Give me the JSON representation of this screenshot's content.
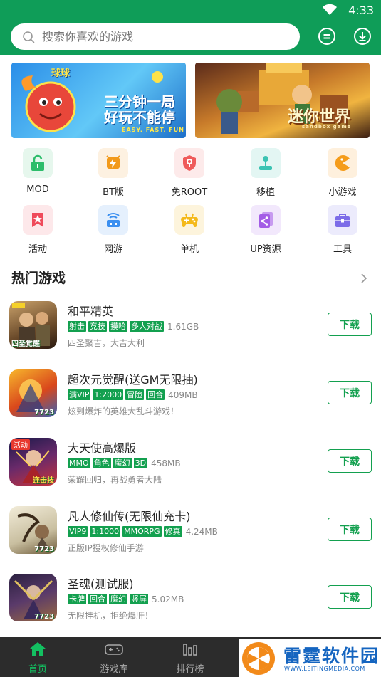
{
  "status_bar": {
    "time": "4:33"
  },
  "search": {
    "placeholder": "搜索你喜欢的游戏"
  },
  "banners": [
    {
      "title": "球球",
      "slogan_line1": "三分钟一局",
      "slogan_line2": "好玩不能停",
      "sub": "EASY. FAST. FUN"
    },
    {
      "title": "迷你世界",
      "sub": "sandbox game"
    }
  ],
  "categories": [
    {
      "label": "MOD",
      "icon": "lock-icon",
      "color": "#2dbd6b",
      "bg": "#e6f7ed"
    },
    {
      "label": "BT版",
      "icon": "bt-icon",
      "color": "#f29a1b",
      "bg": "#fdf1e1"
    },
    {
      "label": "免ROOT",
      "icon": "shield-icon",
      "color": "#ef5b5b",
      "bg": "#fdeaea"
    },
    {
      "label": "移植",
      "icon": "joystick-icon",
      "color": "#3cc3b3",
      "bg": "#e3f6f3"
    },
    {
      "label": "小游戏",
      "icon": "pacman-icon",
      "color": "#f59c1a",
      "bg": "#fef0dd"
    },
    {
      "label": "活动",
      "icon": "star-bookmark-icon",
      "color": "#ef4b5b",
      "bg": "#fde8ea"
    },
    {
      "label": "网游",
      "icon": "network-icon",
      "color": "#3b8ff0",
      "bg": "#e5f0fd"
    },
    {
      "label": "单机",
      "icon": "gamepad-icon",
      "color": "#f4b91a",
      "bg": "#fdf4dc"
    },
    {
      "label": "UP资源",
      "icon": "share-icon",
      "color": "#a35ce6",
      "bg": "#f2e8fc"
    },
    {
      "label": "工具",
      "icon": "toolbox-icon",
      "color": "#7c6ce8",
      "bg": "#ecebfc"
    }
  ],
  "section": {
    "title": "热门游戏"
  },
  "games": [
    {
      "name": "和平精英",
      "tags": [
        "射击",
        "竞技",
        "摸哈",
        "多人对战"
      ],
      "size": "1.61GB",
      "desc": "四圣聚吉，大吉大利",
      "button": "下载",
      "icon_badge": "",
      "icon_label": "四圣觉醒",
      "colors": [
        "#6a4a2a",
        "#c9a16a"
      ]
    },
    {
      "name": "超次元觉醒(送GM无限抽)",
      "tags": [
        "满VIP",
        "1:2000",
        "冒险",
        "回合"
      ],
      "size": "409MB",
      "desc": "炫到爆炸的英雄大乱斗游戏！",
      "button": "下载",
      "icon_badge": "",
      "icon_label": "7723",
      "colors": [
        "#d9471c",
        "#f7b62c"
      ]
    },
    {
      "name": "大天使高爆版",
      "tags": [
        "MMO",
        "角色",
        "魔幻",
        "3D"
      ],
      "size": "458MB",
      "desc": "荣耀回归，再战勇者大陆",
      "button": "下载",
      "icon_badge": "活动",
      "icon_label": "连击技",
      "colors": [
        "#2a1a5a",
        "#c8333a"
      ]
    },
    {
      "name": "凡人修仙传(无限仙充卡)",
      "tags": [
        "VIP9",
        "1:1000",
        "MMORPG",
        "修真"
      ],
      "size": "4.24MB",
      "desc": "正版IP授权修仙手游",
      "button": "下载",
      "icon_badge": "",
      "icon_label": "7723",
      "colors": [
        "#e9e2cf",
        "#6d5a3a"
      ]
    },
    {
      "name": "圣魂(测试服)",
      "tags": [
        "卡牌",
        "回合",
        "魔幻",
        "竖屏"
      ],
      "size": "5.02MB",
      "desc": "无限挂机，拒绝爆肝！",
      "button": "下载",
      "icon_badge": "",
      "icon_label": "7723",
      "colors": [
        "#2a2040",
        "#9a6a40"
      ]
    }
  ],
  "bottom_nav": [
    {
      "label": "首页",
      "icon": "home-icon",
      "active": true
    },
    {
      "label": "游戏库",
      "icon": "gamepad-icon",
      "active": false
    },
    {
      "label": "排行榜",
      "icon": "bar-chart-icon",
      "active": false
    }
  ],
  "watermark": {
    "text": "雷霆软件园",
    "url": "WWW.LEITINGMEDIA.COM"
  },
  "accent_color": "#0f9d58"
}
